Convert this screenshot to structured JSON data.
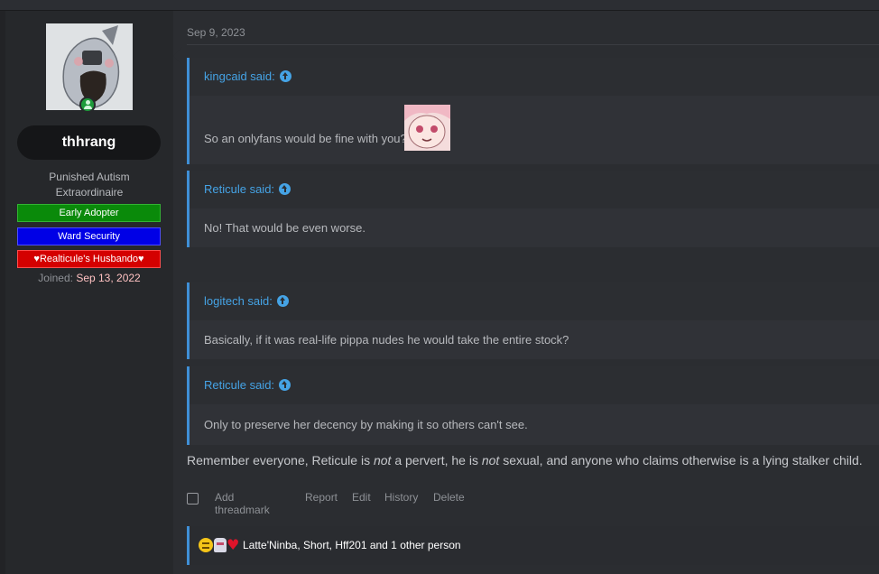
{
  "user": {
    "username": "thhrang",
    "title_line1": "Punished Autism",
    "title_line2": "Extraordinaire",
    "banners": [
      "Early Adopter",
      "Ward Security",
      "♥Realticule's Husbando♥"
    ],
    "joined_label": "Joined:",
    "joined_date": "Sep 13, 2022",
    "online": true
  },
  "post": {
    "date": "Sep 9, 2023",
    "quotes": [
      {
        "author": "kingcaid said:",
        "text": "So an onlyfans would be fine with you?"
      },
      {
        "author": "Reticule said:",
        "text": "No! That would be even worse."
      },
      {
        "author": "logitech said:",
        "text": "Basically, if it was real-life pippa nudes he would take the entire stock?"
      },
      {
        "author": "Reticule said:",
        "text": "Only to preserve her decency by making it so others can't see."
      }
    ],
    "message": {
      "part1": "Remember everyone, Reticule is ",
      "em1": "not",
      "part2": " a pervert, he is ",
      "em2": "not",
      "part3": " sexual, and anyone who claims otherwise is a lying stalker child."
    },
    "actions": [
      "Add threadmark",
      "Report",
      "Edit",
      "History",
      "Delete"
    ],
    "reactions": {
      "icons": [
        "thinking-emoji-icon",
        "anime-face-emoji-icon",
        "heart-emoji-icon"
      ],
      "text": "Latte'Ninba, Short, Hff201 and 1 other person"
    }
  },
  "colors": {
    "link": "#45a3e5",
    "banner_green": "#0a8a0a",
    "banner_blue": "#0000e6",
    "banner_red": "#d40000",
    "online": "#1e9b3b"
  }
}
